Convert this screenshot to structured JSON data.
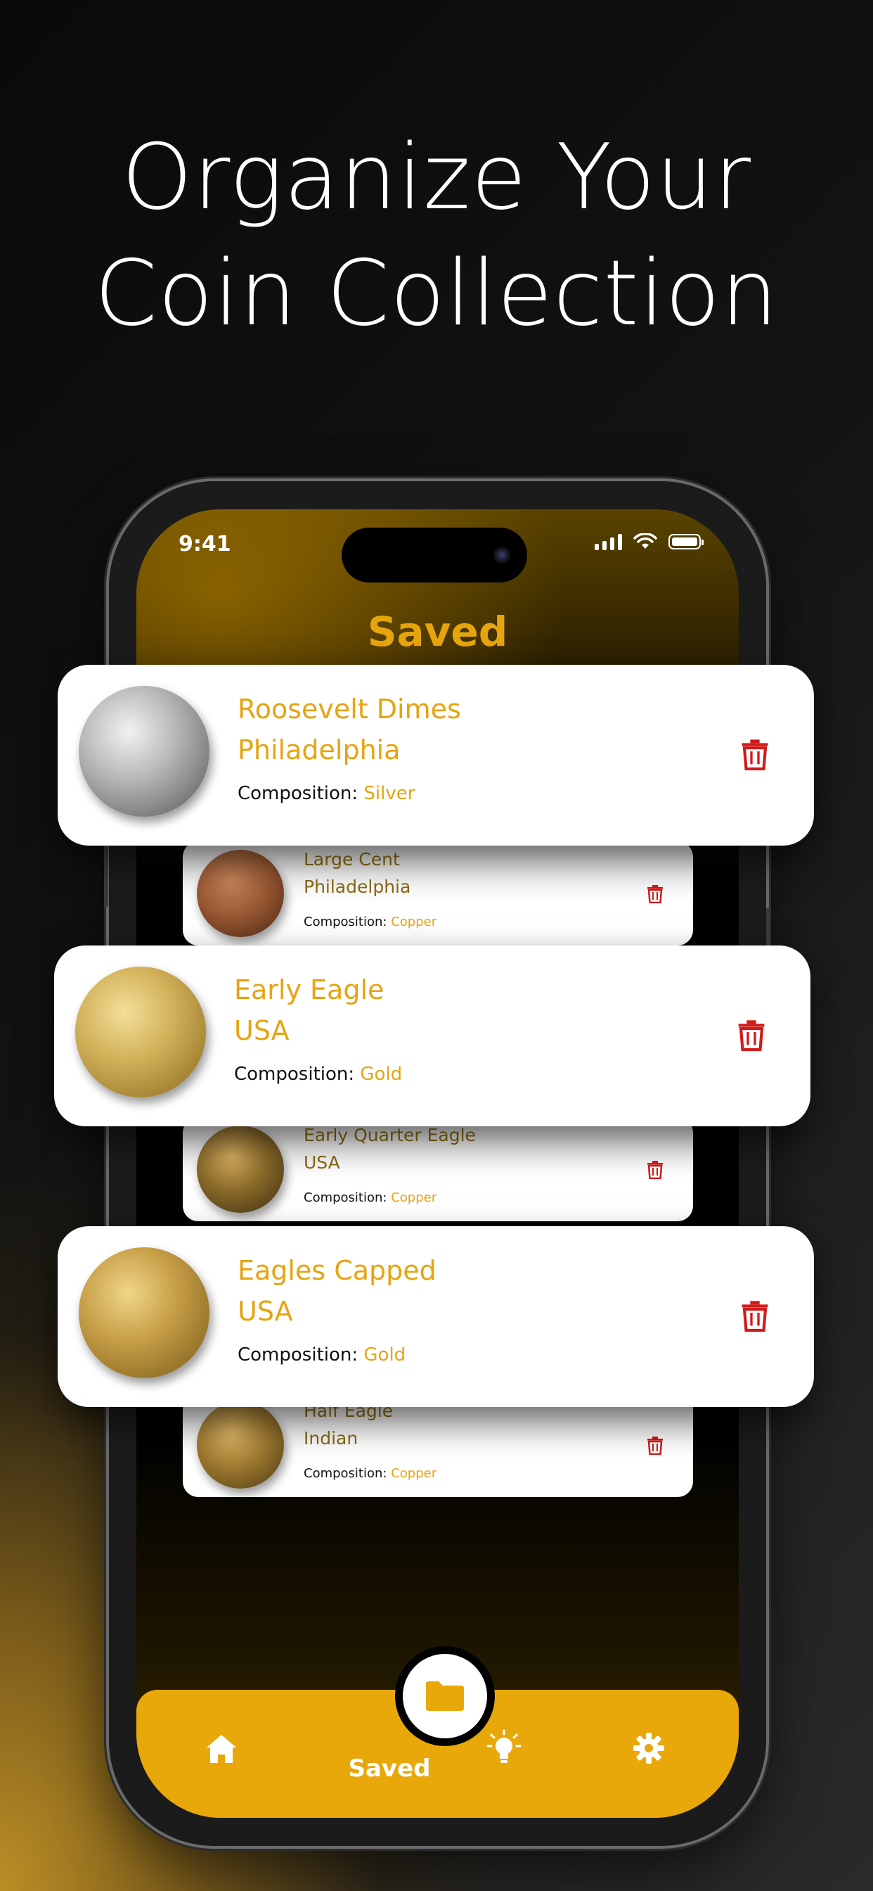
{
  "headline": [
    "Organize Your",
    "Coin Collection"
  ],
  "status": {
    "time": "9:41"
  },
  "screen": {
    "title": "Saved"
  },
  "cards": [
    {
      "name_line1": "Roosevelt Dimes",
      "name_line2": "Philadelphia",
      "comp_label": "Composition:",
      "comp_value": "Silver",
      "coin": "silver"
    },
    {
      "name_line1": "Large Cent",
      "name_line2": "Philadelphia",
      "comp_label": "Composition:",
      "comp_value": "Copper",
      "coin": "copper"
    },
    {
      "name_line1": "Early Eagle",
      "name_line2": "USA",
      "comp_label": "Composition:",
      "comp_value": "Gold",
      "coin": "gold"
    },
    {
      "name_line1": "Early Quarter Eagle",
      "name_line2": "USA",
      "comp_label": "Composition:",
      "comp_value": "Copper",
      "coin": "gold-dark"
    },
    {
      "name_line1": "Eagles Capped",
      "name_line2": "USA",
      "comp_label": "Composition:",
      "comp_value": "Gold",
      "coin": "gold"
    },
    {
      "name_line1": "Half Eagle",
      "name_line2": "Indian",
      "comp_label": "Composition:",
      "comp_value": "Copper",
      "coin": "gold-dark"
    }
  ],
  "nav": {
    "items": [
      {
        "icon": "home-icon"
      },
      {
        "icon": "folder-icon",
        "label": "Saved"
      },
      {
        "icon": "lightbulb-icon"
      },
      {
        "icon": "gear-icon"
      }
    ]
  },
  "colors": {
    "accent": "#e8a80a",
    "delete": "#d11a1a"
  }
}
